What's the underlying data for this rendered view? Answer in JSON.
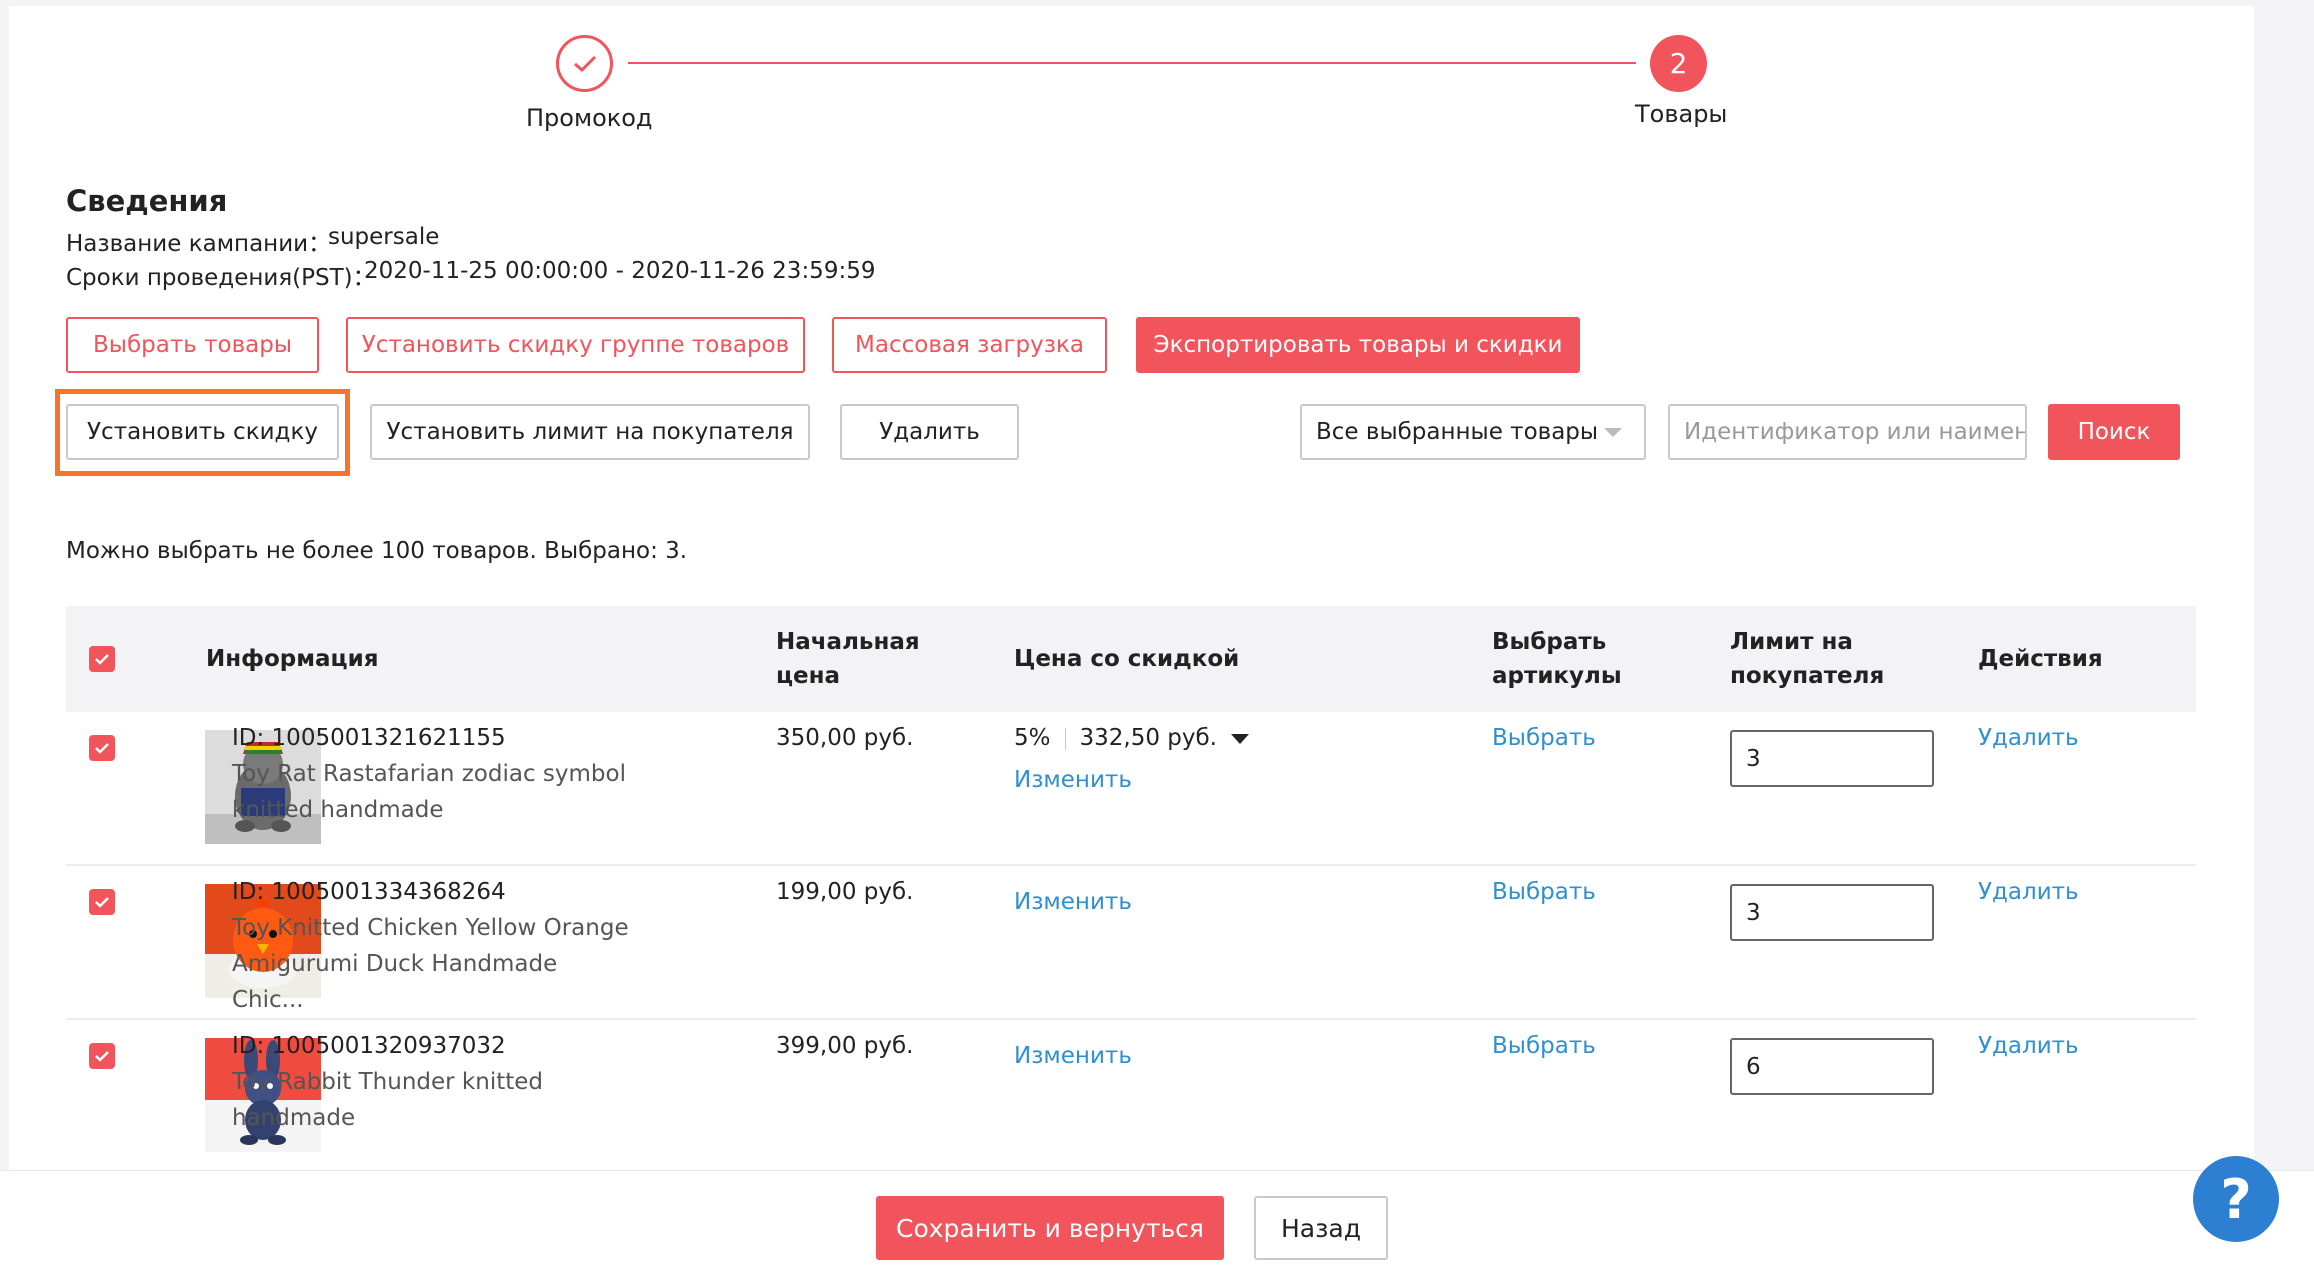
{
  "steps": [
    {
      "label": "Промокод",
      "state": "done"
    },
    {
      "label": "Товары",
      "number": "2",
      "state": "active"
    }
  ],
  "details": {
    "title": "Сведения",
    "campaign_name_label": "Название кампании：",
    "campaign_name": "supersale",
    "period_label": "Сроки проведения(PST)：",
    "period": "2020-11-25 00:00:00 - 2020-11-26 23:59:59"
  },
  "toolbar": {
    "select_products": "Выбрать товары",
    "group_discount": "Установить скидку группе товаров",
    "bulk_upload": "Массовая загрузка",
    "export": "Экспортировать товары и скидки",
    "set_discount": "Установить скидку",
    "set_limit": "Установить лимит на покупателя",
    "delete": "Удалить",
    "filter_value": "Все выбранные товары",
    "search_placeholder": "Идентификатор или наименование",
    "search": "Поиск"
  },
  "note": "Можно выбрать не более 100 товаров. Выбрано: 3.",
  "table": {
    "headers": {
      "info": "Информация",
      "base_price": "Начальная цена",
      "discount_price": "Цена со скидкой",
      "select_sku": "Выбрать артикулы",
      "limit": "Лимит на покупателя",
      "actions": "Действия"
    },
    "rows": [
      {
        "id": "ID: 1005001321621155",
        "name": "Toy Rat Rastafarian zodiac symbol knitted handmade",
        "base_price": "350,00 руб.",
        "discount_percent": "5%",
        "discount_price": "332,50 руб.",
        "edit": "Изменить",
        "select": "Выбрать",
        "limit": "3",
        "delete": "Удалить"
      },
      {
        "id": "ID: 1005001334368264",
        "name": "Toy Knitted Chicken Yellow Orange Amigurumi Duck Handmade Chic...",
        "base_price": "199,00 руб.",
        "edit": "Изменить",
        "select": "Выбрать",
        "limit": "3",
        "delete": "Удалить"
      },
      {
        "id": "ID: 1005001320937032",
        "name": "Toy Rabbit Thunder knitted handmade",
        "base_price": "399,00 руб.",
        "edit": "Изменить",
        "select": "Выбрать",
        "limit": "6",
        "delete": "Удалить"
      }
    ]
  },
  "footer": {
    "save": "Сохранить и вернуться",
    "back": "Назад"
  },
  "help": "?",
  "colors": {
    "accent": "#f2545b",
    "link": "#2f8fd1",
    "highlight": "#f7742a",
    "help": "#2d7fd1"
  }
}
